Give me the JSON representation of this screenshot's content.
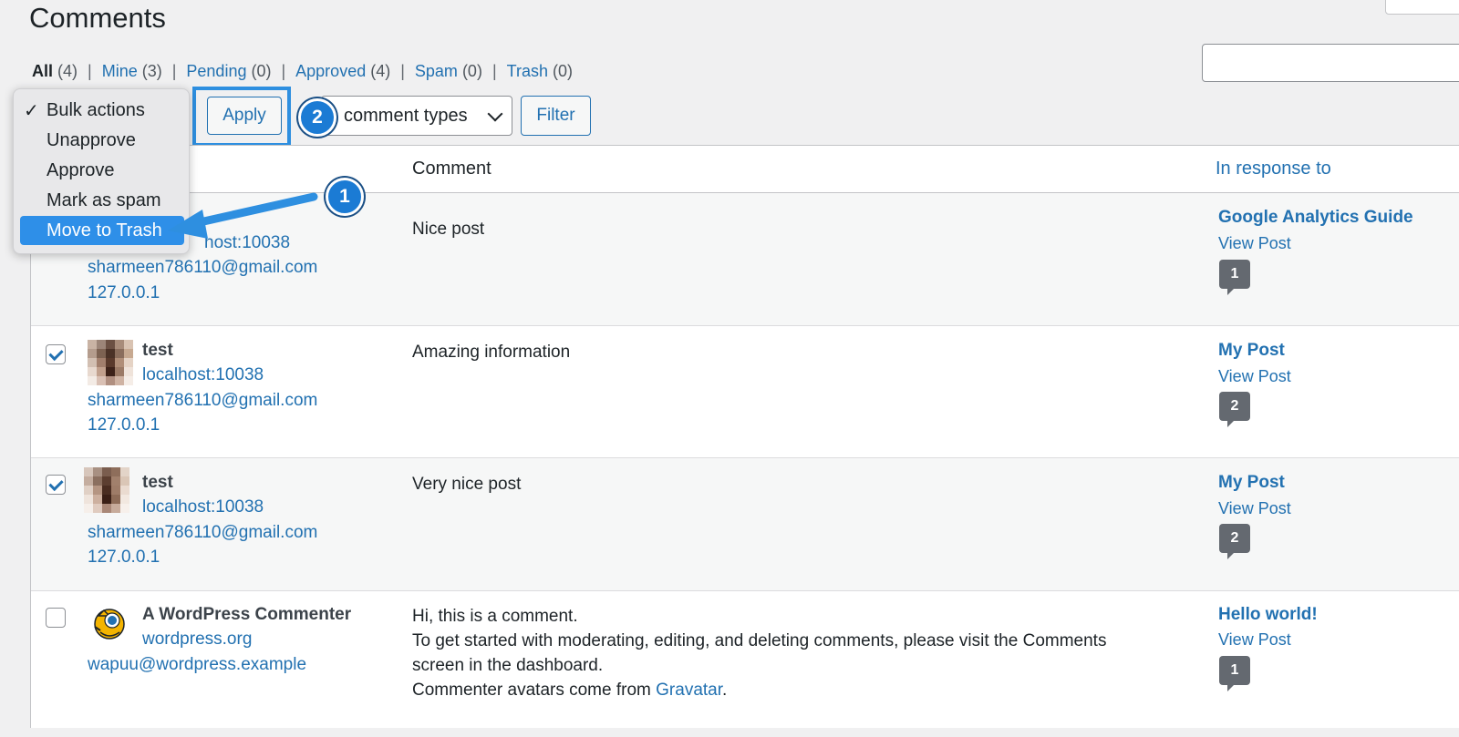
{
  "page": {
    "title": "Comments"
  },
  "views": [
    {
      "label": "All",
      "count": "(4)"
    },
    {
      "label": "Mine",
      "count": "(3)"
    },
    {
      "label": "Pending",
      "count": "(0)"
    },
    {
      "label": "Approved",
      "count": "(4)"
    },
    {
      "label": "Spam",
      "count": "(0)"
    },
    {
      "label": "Trash",
      "count": "(0)"
    }
  ],
  "toolbar": {
    "apply_label": "Apply",
    "type_select_value": "comment types",
    "filter_label": "Filter"
  },
  "bulk_menu": {
    "check_mark": "✓",
    "items": [
      "Bulk actions",
      "Unapprove",
      "Approve",
      "Mark as spam",
      "Move to Trash"
    ],
    "selected": "Move to Trash"
  },
  "steps": {
    "step1": "1",
    "step2": "2"
  },
  "table": {
    "columns": {
      "comment": "Comment",
      "response": "In response to"
    },
    "rows": [
      {
        "author": "",
        "url": "localhost:10038",
        "url_visible": "host:10038",
        "email": "sharmeen786110@gmail.com",
        "ip": "127.0.0.1",
        "comment": "Nice post",
        "post": "Google Analytics Guide",
        "view": "View Post",
        "count": "1",
        "checked": false
      },
      {
        "author": "test",
        "url": "localhost:10038",
        "email": "sharmeen786110@gmail.com",
        "ip": "127.0.0.1",
        "comment": "Amazing information",
        "post": "My Post",
        "view": "View Post",
        "count": "2",
        "checked": true
      },
      {
        "author": "test",
        "url": "localhost:10038",
        "email": "sharmeen786110@gmail.com",
        "ip": "127.0.0.1",
        "comment": "Very nice post",
        "post": "My Post",
        "view": "View Post",
        "count": "2",
        "checked": true
      },
      {
        "author": "A WordPress Commenter",
        "url": "wordpress.org",
        "email": "wapuu@wordpress.example",
        "comment_lines": [
          "Hi, this is a comment.",
          "To get started with moderating, editing, and deleting comments, please visit the Comments",
          "screen in the dashboard."
        ],
        "comment_last_prefix": "Commenter avatars come from",
        "comment_link": "Gravatar",
        "comment_last_suffix": ".",
        "post": "Hello world!",
        "view": "View Post",
        "count": "1",
        "checked": false
      }
    ]
  },
  "colors": {
    "link": "#2271b1",
    "highlight": "#2e8fe0",
    "menu_selected": "#2e8fe8"
  },
  "icons": [
    "checkmark-icon",
    "chevron-down-icon",
    "arrow-annotation-icon",
    "comment-bubble-icon",
    "avatar-image"
  ]
}
